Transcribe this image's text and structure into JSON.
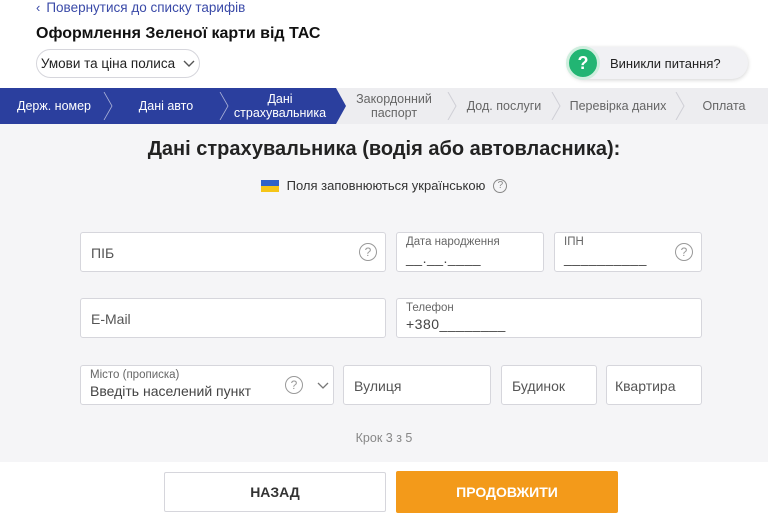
{
  "header": {
    "back_link": "Повернутися до списку тарифів",
    "title": "Оформлення Зеленої карти від ТАС",
    "conditions_button": "Умови та ціна полиса"
  },
  "help": {
    "icon": "?",
    "label": "Виникли питання?"
  },
  "steps": [
    {
      "label": "Держ. номер",
      "state": "done"
    },
    {
      "label": "Дані авто",
      "state": "done"
    },
    {
      "label": "Дані страхувальника",
      "state": "current"
    },
    {
      "label": "Закордонний паспорт",
      "state": "todo"
    },
    {
      "label": "Дод. послуги",
      "state": "todo"
    },
    {
      "label": "Перевірка даних",
      "state": "todo"
    },
    {
      "label": "Оплата",
      "state": "todo"
    }
  ],
  "form": {
    "title": "Дані страхувальника (водія або автовласника):",
    "lang_note": "Поля заповнюються українською",
    "help_icon": "?",
    "fields": {
      "pib": {
        "placeholder": "ПІБ"
      },
      "birth": {
        "label": "Дата народження",
        "value": "__.__.____"
      },
      "ipn": {
        "label": "ІПН",
        "value": "__________"
      },
      "email": {
        "placeholder": "E-Mail"
      },
      "phone": {
        "label": "Телефон",
        "value": "+380________"
      },
      "city": {
        "label": "Місто (прописка)",
        "value": "Введіть населений пункт"
      },
      "street": {
        "placeholder": "Вулиця"
      },
      "house": {
        "placeholder": "Будинок"
      },
      "apartment": {
        "placeholder": "Квартира"
      }
    },
    "step_counter": "Крок 3 з 5"
  },
  "footer": {
    "back_button": "НАЗАД",
    "next_button": "ПРОДОВЖИТИ"
  },
  "colors": {
    "primary": "#2b3f9e",
    "accent": "#f39a1a",
    "help": "#22b573"
  }
}
